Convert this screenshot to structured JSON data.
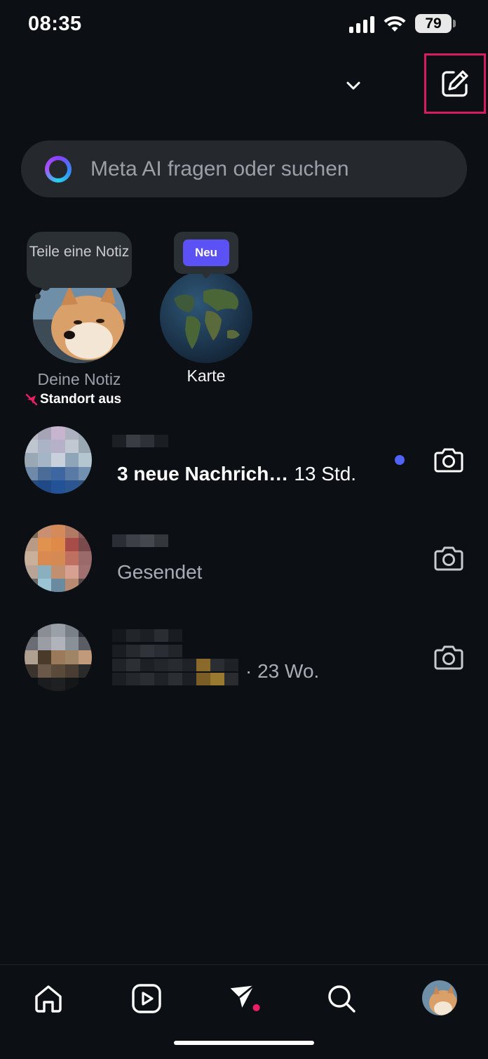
{
  "status_bar": {
    "time": "08:35",
    "battery": "79"
  },
  "header": {
    "chevron_icon": "chevron-down-icon",
    "compose_icon": "compose-edit-icon",
    "highlight_color": "#d81b60"
  },
  "search": {
    "placeholder": "Meta AI fragen oder suchen",
    "icon": "meta-ai-ring-icon"
  },
  "notes": {
    "own_note": {
      "bubble_text": "Teile eine Notiz",
      "label": "Deine Notiz",
      "location_status": "Standort aus"
    },
    "map": {
      "badge": "Neu",
      "label": "Karte"
    }
  },
  "conversations": [
    {
      "preview_bold": "3 neue Nachrich…",
      "time": "13 Std.",
      "unread": true,
      "action_icon": "camera-icon"
    },
    {
      "preview": "Gesendet",
      "action_icon": "camera-icon"
    },
    {
      "time": "· 23 Wo.",
      "action_icon": "camera-icon"
    }
  ],
  "tabbar": {
    "items": [
      "home-icon",
      "reels-icon",
      "messages-icon",
      "search-icon",
      "profile-avatar"
    ]
  },
  "colors": {
    "background": "#0c1014",
    "accent_blue": "#4f63f7",
    "badge_purple": "#5b51f5",
    "notification_pink": "#e91e63"
  }
}
